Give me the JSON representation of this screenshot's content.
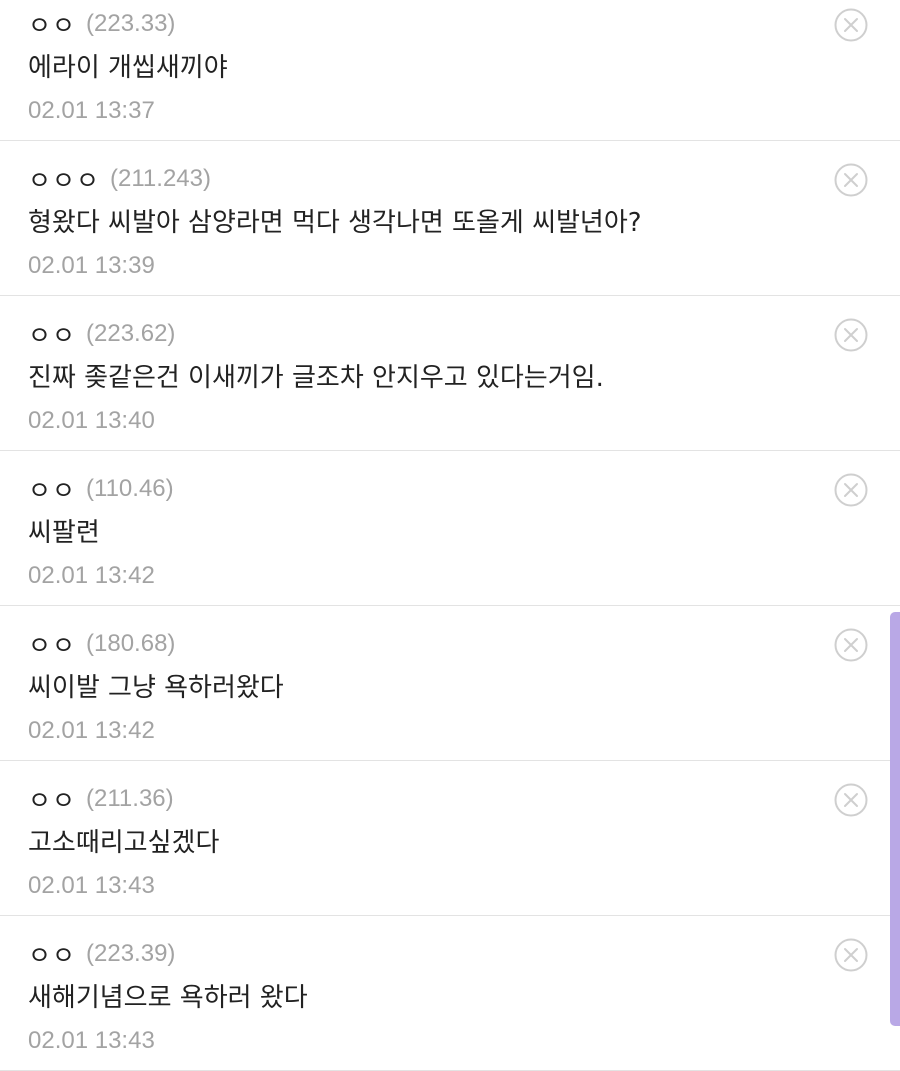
{
  "comments": [
    {
      "nick": "ㅇㅇ",
      "ip": "(223.33)",
      "text": "에라이 개씹새끼야",
      "time": "02.01 13:37"
    },
    {
      "nick": "ㅇㅇㅇ",
      "ip": "(211.243)",
      "text": "형왔다 씨발아 삼양라면 먹다 생각나면 또올게 씨발년아?",
      "time": "02.01 13:39"
    },
    {
      "nick": "ㅇㅇ",
      "ip": "(223.62)",
      "text": "진짜 좆같은건 이새끼가 글조차 안지우고 있다는거임.",
      "time": "02.01 13:40"
    },
    {
      "nick": "ㅇㅇ",
      "ip": "(110.46)",
      "text": "씨팔련",
      "time": "02.01 13:42"
    },
    {
      "nick": "ㅇㅇ",
      "ip": "(180.68)",
      "text": "씨이발 그냥 욕하러왔다",
      "time": "02.01 13:42"
    },
    {
      "nick": "ㅇㅇ",
      "ip": "(211.36)",
      "text": "고소때리고싶겠다",
      "time": "02.01 13:43"
    },
    {
      "nick": "ㅇㅇ",
      "ip": "(223.39)",
      "text": "새해기념으로 욕하러 왔다",
      "time": "02.01 13:43"
    }
  ],
  "icons": {
    "delete": "close-circle-icon"
  },
  "colors": {
    "text": "#222222",
    "meta": "#a3a3a3",
    "divider": "#e3e3e3",
    "scrollbar": "#b9a8e6"
  }
}
